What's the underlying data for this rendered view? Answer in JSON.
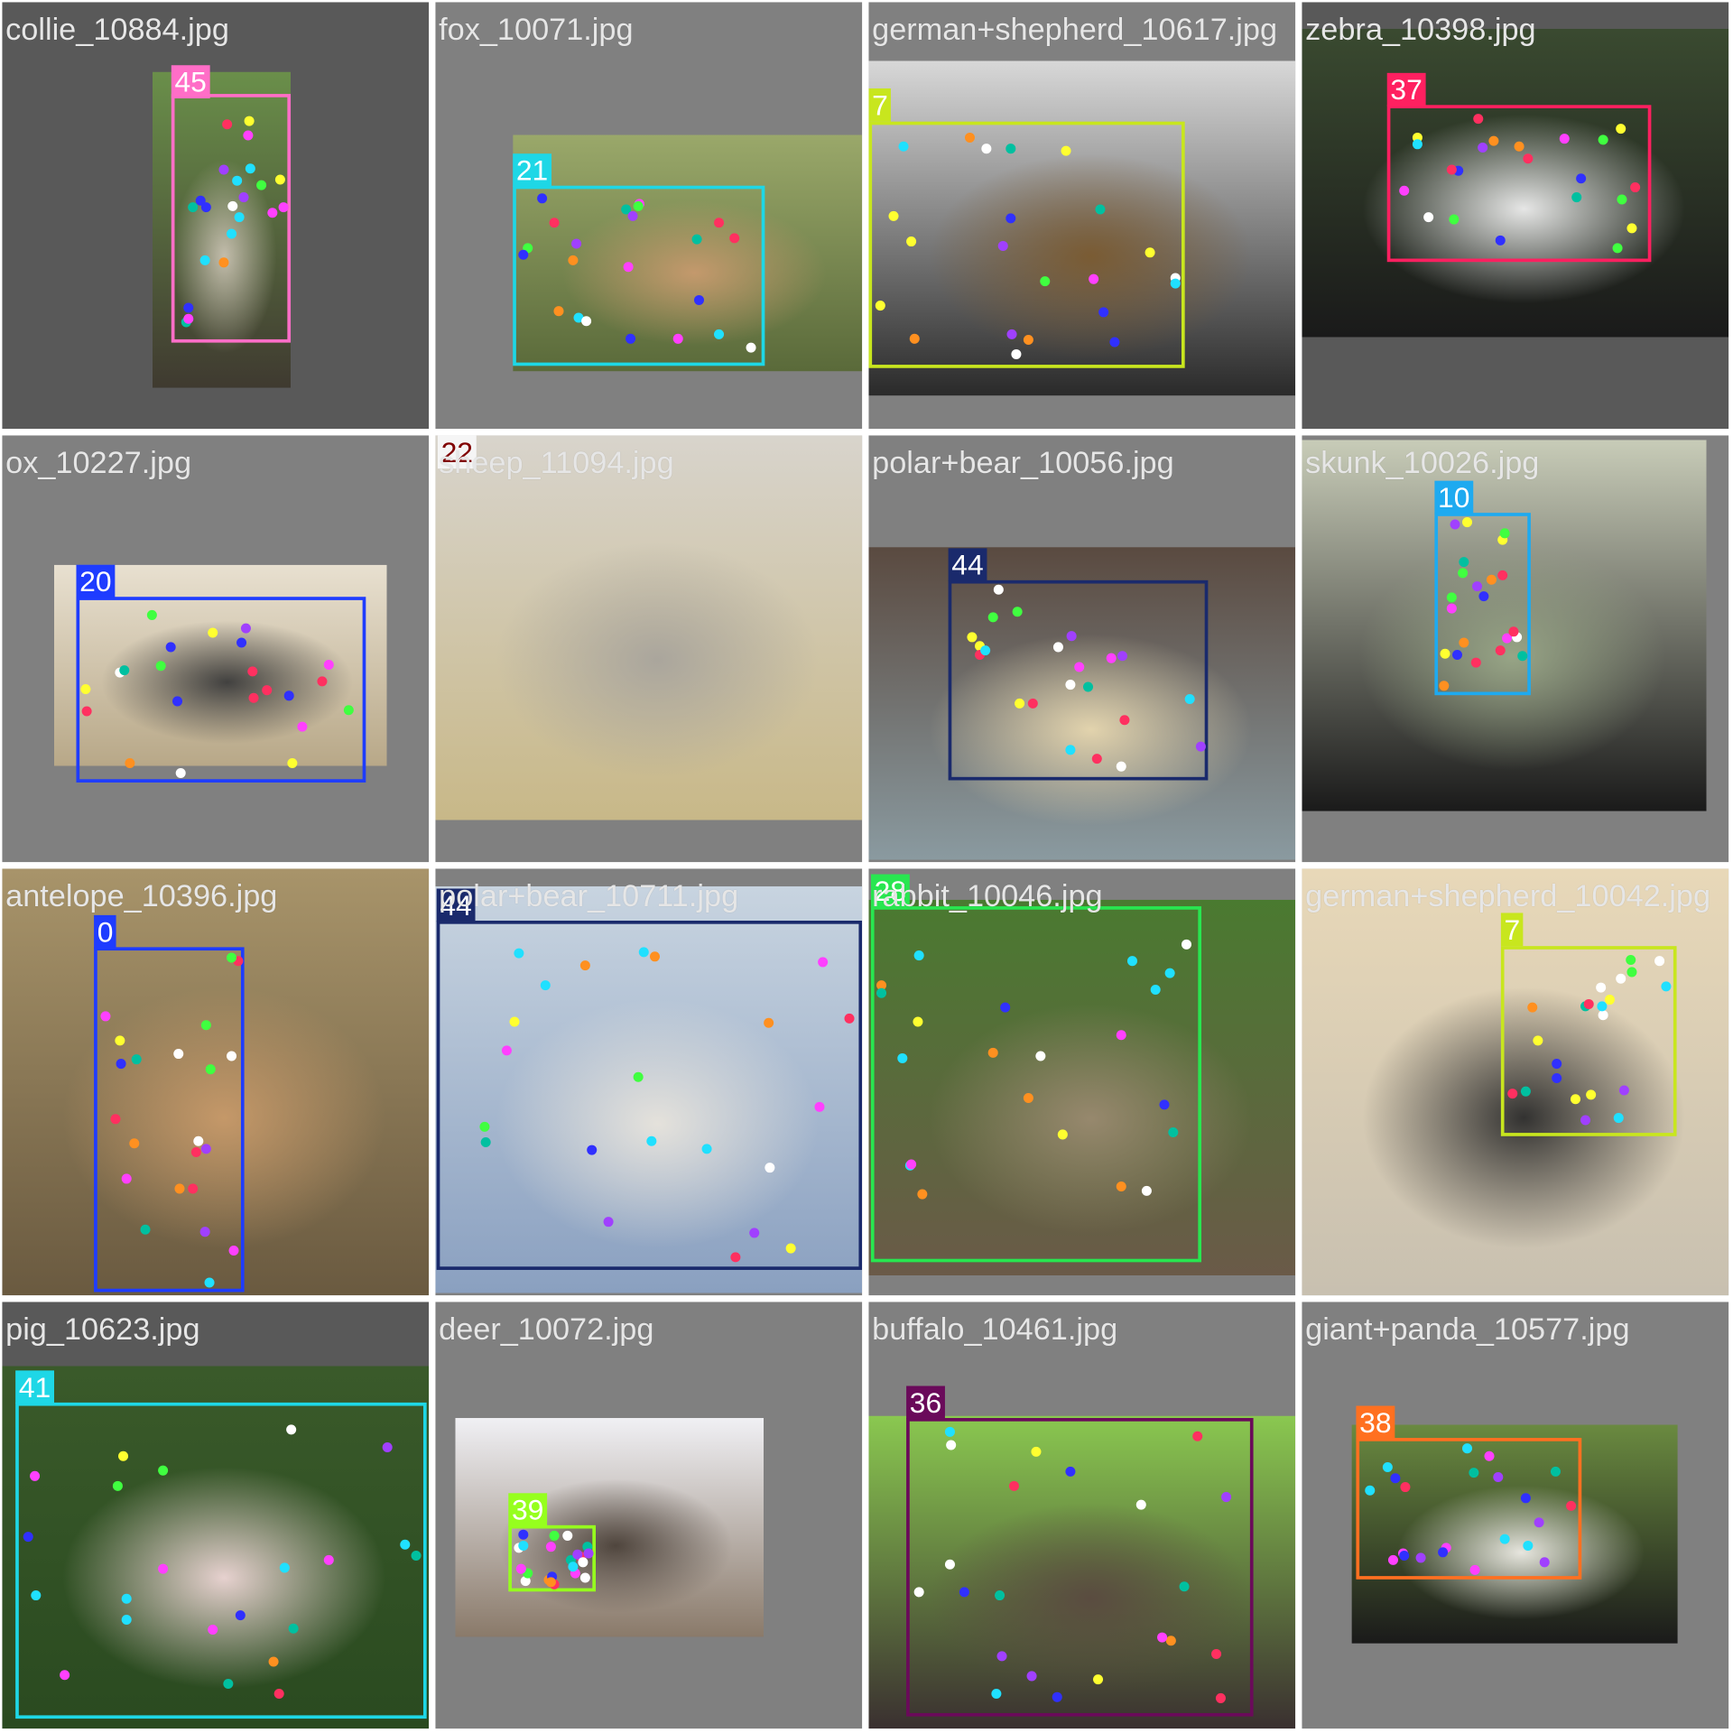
{
  "grid": {
    "background": "#ffffff",
    "tiles": [
      {
        "filename": "collie_10884.jpg",
        "theme": "dark",
        "photo_colors": [
          "#6a8f4a",
          "#c9c2b2",
          "#3f3a30"
        ],
        "detections": [
          {
            "label": "45",
            "color": "#ff6ec7"
          }
        ]
      },
      {
        "filename": "fox_10071.jpg",
        "theme": "light",
        "photo_colors": [
          "#9aa86a",
          "#c89a6e",
          "#5a6a3a"
        ],
        "detections": [
          {
            "label": "21",
            "color": "#1ed7e6"
          }
        ]
      },
      {
        "filename": "german+shepherd_10617.jpg",
        "theme": "light",
        "photo_colors": [
          "#d8d8d8",
          "#7a5a30",
          "#2a2a2a"
        ],
        "detections": [
          {
            "label": "7",
            "color": "#c8e61e"
          }
        ]
      },
      {
        "filename": "zebra_10398.jpg",
        "theme": "dark",
        "photo_colors": [
          "#3a4a30",
          "#f0f0f0",
          "#1a1a1a"
        ],
        "detections": [
          {
            "label": "37",
            "color": "#ff2060"
          }
        ]
      },
      {
        "filename": "ox_10227.jpg",
        "theme": "light",
        "photo_colors": [
          "#e8e0d0",
          "#3a3a3a",
          "#b8a888"
        ],
        "detections": [
          {
            "label": "20",
            "color": "#1e3cff"
          }
        ]
      },
      {
        "filename": "sheep_11094.jpg",
        "theme": "light",
        "photo_colors": [
          "#d8d4cc",
          "#a8a49c",
          "#c8b888"
        ],
        "detections": [
          {
            "label": "22",
            "color": "#f5f5f5",
            "text_color": "#800000"
          }
        ]
      },
      {
        "filename": "polar+bear_10056.jpg",
        "theme": "light",
        "photo_colors": [
          "#5a4a40",
          "#e8d8b0",
          "#8a9aa0"
        ],
        "detections": [
          {
            "label": "44",
            "color": "#1a2a6c"
          }
        ]
      },
      {
        "filename": "skunk_10026.jpg",
        "theme": "light",
        "photo_colors": [
          "#c8ccb8",
          "#9aa888",
          "#1a1a1a"
        ],
        "detections": [
          {
            "label": "10",
            "color": "#1eaaf0"
          }
        ]
      },
      {
        "filename": "antelope_10396.jpg",
        "theme": "light",
        "photo_colors": [
          "#a8946a",
          "#c89a6a",
          "#6a5a40"
        ],
        "detections": [
          {
            "label": "0",
            "color": "#1e3cff"
          }
        ]
      },
      {
        "filename": "polar+bear_10711.jpg",
        "theme": "light",
        "photo_colors": [
          "#c8d4e0",
          "#e8e4dc",
          "#8aa0c0"
        ],
        "detections": [
          {
            "label": "44",
            "color": "#1a2a6c"
          }
        ]
      },
      {
        "filename": "rabbit_10046.jpg",
        "theme": "light",
        "photo_colors": [
          "#4a7a30",
          "#9a8a70",
          "#6a5a48"
        ],
        "detections": [
          {
            "label": "28",
            "color": "#28e650"
          }
        ]
      },
      {
        "filename": "german+shepherd_10042.jpg",
        "theme": "light",
        "photo_colors": [
          "#e8d8b8",
          "#2a2a2a",
          "#c8c0b0"
        ],
        "detections": [
          {
            "label": "7",
            "color": "#c8e61e"
          }
        ]
      },
      {
        "filename": "pig_10623.jpg",
        "theme": "dark",
        "photo_colors": [
          "#3a5a2a",
          "#f0d8d8",
          "#2a4a20"
        ],
        "detections": [
          {
            "label": "41",
            "color": "#1ed7e6"
          }
        ]
      },
      {
        "filename": "deer_10072.jpg",
        "theme": "light",
        "photo_colors": [
          "#f0f0f4",
          "#4a4038",
          "#8a7a6a"
        ],
        "detections": [
          {
            "label": "39",
            "color": "#96ff1e"
          }
        ]
      },
      {
        "filename": "buffalo_10461.jpg",
        "theme": "light",
        "photo_colors": [
          "#8ac850",
          "#5a4a40",
          "#3a3030"
        ],
        "detections": [
          {
            "label": "36",
            "color": "#6a0a5a"
          }
        ]
      },
      {
        "filename": "giant+panda_10577.jpg",
        "theme": "light",
        "photo_colors": [
          "#6a8a40",
          "#f0eee8",
          "#1a1a1a"
        ],
        "detections": [
          {
            "label": "38",
            "color": "#ff7020"
          }
        ]
      }
    ],
    "keypoint_palette": [
      "#ff3060",
      "#20e0ff",
      "#ff40ff",
      "#40ff40",
      "#ffff30",
      "#3030ff",
      "#ff9020",
      "#a040ff",
      "#ffffff",
      "#00c0a0"
    ]
  }
}
